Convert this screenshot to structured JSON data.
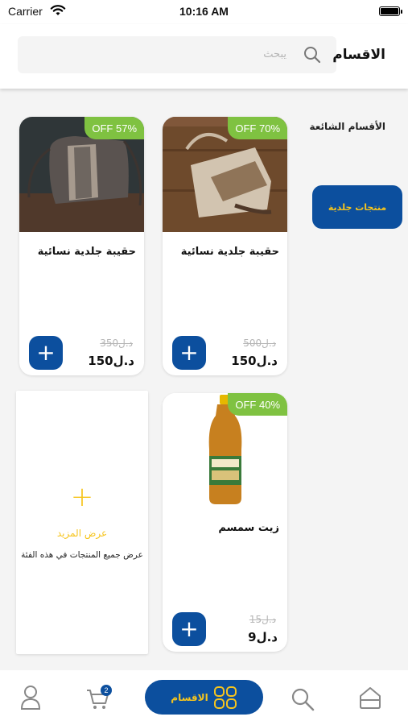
{
  "status_bar": {
    "carrier": "Carrier",
    "time": "10:16 AM"
  },
  "header": {
    "title": "الاقسام",
    "search_placeholder": "يبحث"
  },
  "sidebar": {
    "popular_label": "الأقسام الشائعة",
    "categories": [
      {
        "label": "منتجات جلدية",
        "selected": true
      }
    ]
  },
  "products": [
    {
      "name": "حقيبة جلدية نسائية",
      "discount": "OFF 70%",
      "old_price": "500د.ل",
      "price": "150د.ل"
    },
    {
      "name": "حقيبة جلدية نسائية",
      "discount": "OFF 57%",
      "old_price": "350د.ل",
      "price": "150د.ل"
    },
    {
      "name": "زيت سمسم",
      "discount": "OFF 40%",
      "old_price": "15د.ل",
      "price": "9د.ل"
    }
  ],
  "more_card": {
    "plus": "+",
    "title": "عرض المزيد",
    "subtitle": "عرض جميع المنتجات في هذه الفئة"
  },
  "bottom_nav": {
    "center_label": "الاقسام",
    "cart_count": "2"
  },
  "colors": {
    "primary": "#0c4f9e",
    "accent": "#f6c51e",
    "discount": "#7fc241"
  },
  "icons": [
    "wifi-icon",
    "battery-icon",
    "search-icon",
    "plus-icon",
    "home-icon",
    "grid-icon",
    "cart-icon",
    "profile-icon"
  ]
}
